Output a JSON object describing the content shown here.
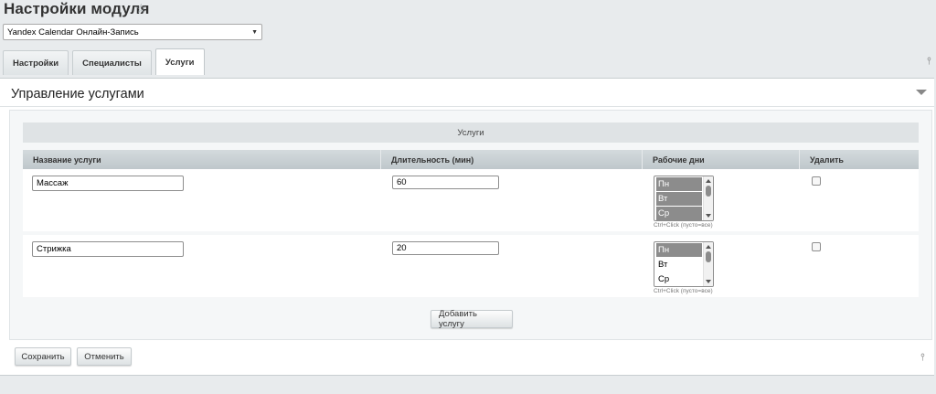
{
  "page": {
    "title": "Настройки модуля"
  },
  "module_select": {
    "value": "Yandex Calendar Онлайн-Запись"
  },
  "tabs": [
    {
      "label": "Настройки",
      "active": false
    },
    {
      "label": "Специалисты",
      "active": false
    },
    {
      "label": "Услуги",
      "active": true
    }
  ],
  "panel": {
    "title": "Управление услугами"
  },
  "services": {
    "section_title": "Услуги",
    "columns": [
      "Название услуги",
      "Длительность (мин)",
      "Рабочие дни",
      "Удалить"
    ],
    "rows": [
      {
        "name": "Массаж",
        "duration": "60",
        "days": [
          {
            "label": "Пн",
            "selected": true
          },
          {
            "label": "Вт",
            "selected": true
          },
          {
            "label": "Ср",
            "selected": true
          }
        ],
        "hint": "Ctrl+Click (пусто=все)",
        "delete": false
      },
      {
        "name": "Стрижка",
        "duration": "20",
        "days": [
          {
            "label": "Пн",
            "selected": true
          },
          {
            "label": "Вт",
            "selected": false
          },
          {
            "label": "Ср",
            "selected": false
          }
        ],
        "hint": "Ctrl+Click (пусто=все)",
        "delete": false
      }
    ],
    "add_button": "Добавить услугу"
  },
  "footer": {
    "save": "Сохранить",
    "cancel": "Отменить"
  },
  "icons": {
    "favorite": "star-icon",
    "pin": "pin-icon",
    "collapse": "collapse-arrow-icon"
  },
  "colors": {
    "selected_option": "#8c8c8c",
    "header_bg": "#dfe3e5"
  }
}
